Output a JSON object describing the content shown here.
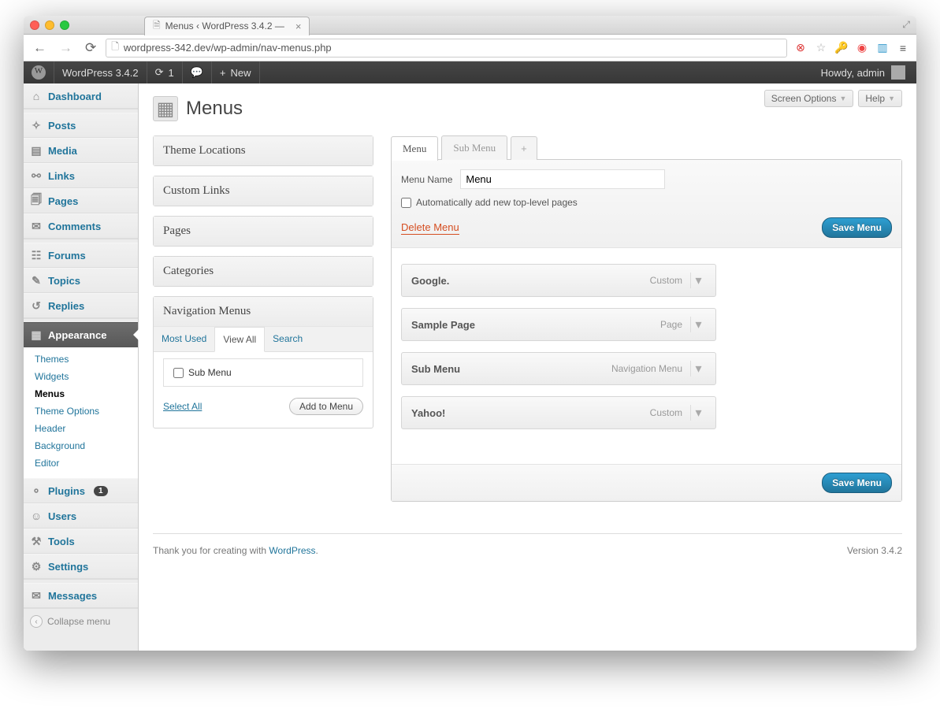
{
  "browser": {
    "tab_title": "Menus ‹ WordPress 3.4.2 —",
    "url": "wordpress-342.dev/wp-admin/nav-menus.php"
  },
  "adminbar": {
    "site_name": "WordPress 3.4.2",
    "updates_count": "1",
    "new_label": "New",
    "howdy": "Howdy, admin"
  },
  "topbuttons": {
    "screen_options": "Screen Options",
    "help": "Help"
  },
  "page_title": "Menus",
  "sidebar": {
    "items": [
      {
        "label": "Dashboard",
        "icon": "⌂"
      },
      {
        "label": "Posts",
        "icon": "📌"
      },
      {
        "label": "Media",
        "icon": "🖼"
      },
      {
        "label": "Links",
        "icon": "🔗"
      },
      {
        "label": "Pages",
        "icon": "📄"
      },
      {
        "label": "Comments",
        "icon": "💬"
      },
      {
        "label": "Forums",
        "icon": "☰"
      },
      {
        "label": "Topics",
        "icon": "✎"
      },
      {
        "label": "Replies",
        "icon": "↩"
      },
      {
        "label": "Appearance",
        "icon": "▦",
        "current": true
      },
      {
        "label": "Plugins",
        "icon": "🔌",
        "badge": "1"
      },
      {
        "label": "Users",
        "icon": "👥"
      },
      {
        "label": "Tools",
        "icon": "🛠"
      },
      {
        "label": "Settings",
        "icon": "⚙"
      },
      {
        "label": "Messages",
        "icon": "✉"
      }
    ],
    "submenu": [
      {
        "label": "Themes"
      },
      {
        "label": "Widgets"
      },
      {
        "label": "Menus",
        "current": true
      },
      {
        "label": "Theme Options"
      },
      {
        "label": "Header"
      },
      {
        "label": "Background"
      },
      {
        "label": "Editor"
      }
    ],
    "collapse": "Collapse menu"
  },
  "metaboxes": {
    "theme_locations": "Theme Locations",
    "custom_links": "Custom Links",
    "pages": "Pages",
    "categories": "Categories",
    "navigation_menus": "Navigation Menus",
    "tabs": {
      "most_used": "Most Used",
      "view_all": "View All",
      "search": "Search"
    },
    "nav_items": [
      {
        "label": "Sub Menu"
      }
    ],
    "select_all": "Select All",
    "add_to_menu": "Add to Menu"
  },
  "menu_editor": {
    "tabs": [
      {
        "label": "Menu",
        "active": true
      },
      {
        "label": "Sub Menu"
      },
      {
        "label": "+",
        "add": true
      }
    ],
    "name_label": "Menu Name",
    "name_value": "Menu",
    "auto_add_label": "Automatically add new top-level pages",
    "delete_label": "Delete Menu",
    "save_label": "Save Menu",
    "items": [
      {
        "title": "Google.",
        "type": "Custom"
      },
      {
        "title": "Sample Page",
        "type": "Page"
      },
      {
        "title": "Sub Menu",
        "type": "Navigation Menu"
      },
      {
        "title": "Yahoo!",
        "type": "Custom"
      }
    ]
  },
  "footer": {
    "thanks_pre": "Thank you for creating with ",
    "thanks_link": "WordPress",
    "version": "Version 3.4.2"
  }
}
